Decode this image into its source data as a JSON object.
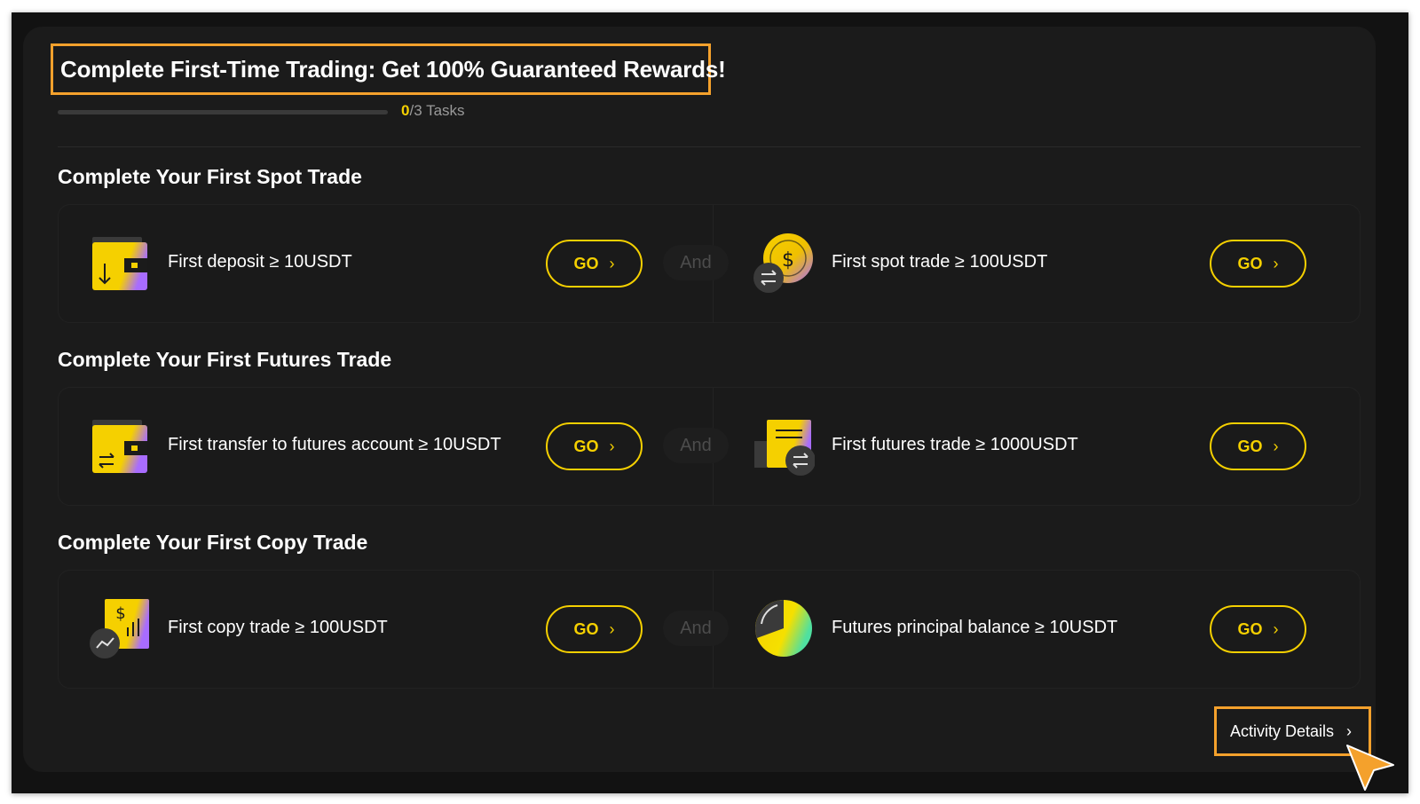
{
  "header": {
    "title": "Complete First-Time Trading: Get 100% Guaranteed Rewards!",
    "progress_done": "0",
    "progress_total": "/3 Tasks",
    "progress_fraction": 0
  },
  "sections": [
    {
      "title": "Complete Your First Spot Trade",
      "and_label": "And",
      "tasks": [
        {
          "label": "First deposit ≥ 10USDT",
          "icon": "wallet-deposit-icon",
          "button": "GO"
        },
        {
          "label": "First spot trade ≥ 100USDT",
          "icon": "coin-exchange-icon",
          "button": "GO"
        }
      ]
    },
    {
      "title": "Complete Your First Futures Trade",
      "and_label": "And",
      "tasks": [
        {
          "label": "First transfer to futures account ≥ 10USDT",
          "icon": "wallet-transfer-icon",
          "button": "GO"
        },
        {
          "label": "First futures trade ≥ 1000USDT",
          "icon": "document-exchange-icon",
          "button": "GO"
        }
      ]
    },
    {
      "title": "Complete Your First Copy Trade",
      "and_label": "And",
      "tasks": [
        {
          "label": "First copy trade ≥ 100USDT",
          "icon": "copy-trade-chart-icon",
          "button": "GO"
        },
        {
          "label": "Futures principal balance ≥ 10USDT",
          "icon": "pie-balance-icon",
          "button": "GO"
        }
      ]
    }
  ],
  "footer": {
    "details_label": "Activity Details"
  },
  "colors": {
    "accent": "#f5d000",
    "highlight_border": "#f4a12c",
    "background": "#1b1b1b",
    "gradient_end": "#a86cff"
  }
}
